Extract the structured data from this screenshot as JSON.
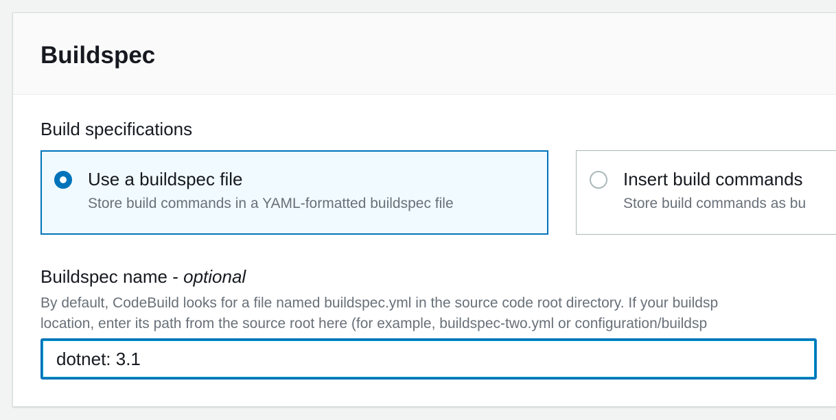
{
  "buildspec": {
    "title": "Buildspec",
    "build_specifications_label": "Build specifications",
    "options": [
      {
        "title": "Use a buildspec file",
        "description": "Store build commands in a YAML-formatted buildspec file",
        "selected": true
      },
      {
        "title": "Insert build commands",
        "description": "Store build commands as bu",
        "selected": false
      }
    ],
    "name_label": "Buildspec name - ",
    "name_label_optional": "optional",
    "help_line_1": "By default, CodeBuild looks for a file named buildspec.yml in the source code root directory. If your buildsp",
    "help_line_2": "location, enter its path from the source root here (for example, buildspec-two.yml or configuration/buildsp",
    "name_value": "dotnet: 3.1"
  },
  "colors": {
    "accent": "#0073bb",
    "selected_tile_bg": "#f1faff",
    "secondary_text": "#687078"
  }
}
